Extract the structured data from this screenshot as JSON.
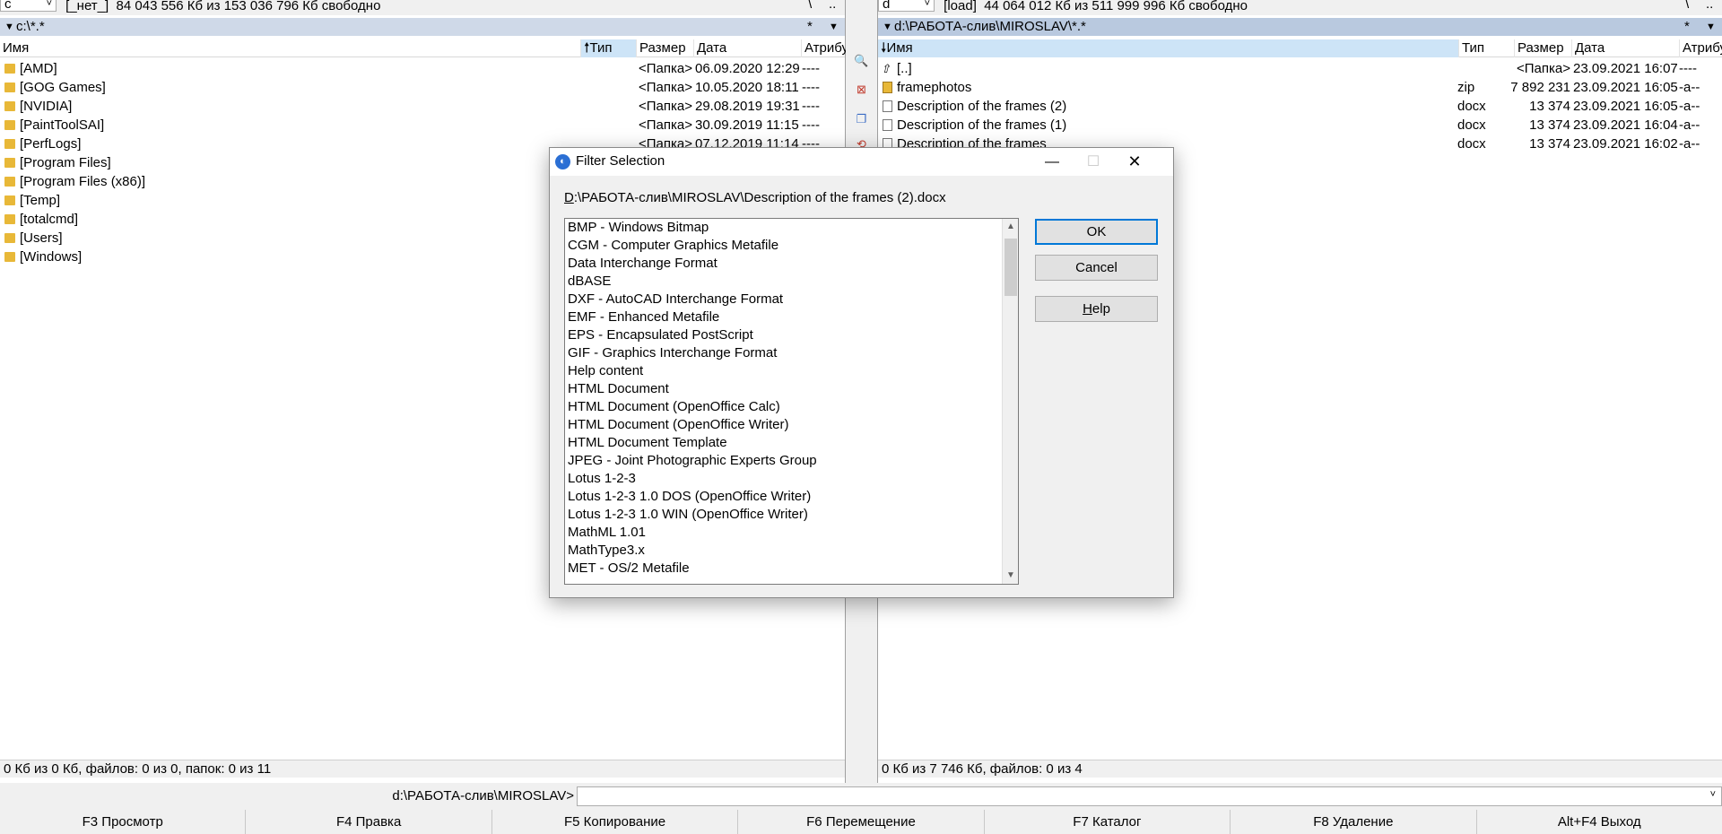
{
  "left_panel": {
    "drive": "c",
    "drive_label": "[_нет_]",
    "free_space": "84 043 556 Кб из 153 036 796 Кб свободно",
    "root_btn": "\\",
    "parent_btn": "..",
    "path": "c:\\*.*",
    "path_star": "*",
    "columns": {
      "name": "Имя",
      "type": "Тип",
      "size": "Размер",
      "date": "Дата",
      "attr": "Атрибу"
    },
    "rows": [
      {
        "name": "[AMD]",
        "size": "<Папка>",
        "date": "06.09.2020 12:29",
        "attr": "----"
      },
      {
        "name": "[GOG Games]",
        "size": "<Папка>",
        "date": "10.05.2020 18:11",
        "attr": "----"
      },
      {
        "name": "[NVIDIA]",
        "size": "<Папка>",
        "date": "29.08.2019 19:31",
        "attr": "----"
      },
      {
        "name": "[PaintToolSAI]",
        "size": "<Папка>",
        "date": "30.09.2019 11:15",
        "attr": "----"
      },
      {
        "name": "[PerfLogs]",
        "size": "<Папка>",
        "date": "07.12.2019 11:14",
        "attr": "----"
      },
      {
        "name": "[Program Files]",
        "size": "",
        "date": "",
        "attr": ""
      },
      {
        "name": "[Program Files (x86)]",
        "size": "",
        "date": "",
        "attr": ""
      },
      {
        "name": "[Temp]",
        "size": "",
        "date": "",
        "attr": ""
      },
      {
        "name": "[totalcmd]",
        "size": "",
        "date": "",
        "attr": ""
      },
      {
        "name": "[Users]",
        "size": "",
        "date": "",
        "attr": ""
      },
      {
        "name": "[Windows]",
        "size": "",
        "date": "",
        "attr": ""
      }
    ],
    "status": "0 Кб из 0 Кб, файлов: 0 из 0, папок: 0 из 11"
  },
  "right_panel": {
    "drive": "d",
    "drive_label": "[load]",
    "free_space": "44 064 012 Кб из 511 999 996 Кб свободно",
    "root_btn": "\\",
    "parent_btn": "..",
    "path": "d:\\РАБОТА-слив\\MIROSLAV\\*.*",
    "path_star": "*",
    "columns": {
      "name": "Имя",
      "type": "Тип",
      "size": "Размер",
      "date": "Дата",
      "attr": "Атрибу"
    },
    "rows": [
      {
        "name": "[..]",
        "type": "",
        "size": "<Папка>",
        "date": "23.09.2021 16:07",
        "attr": "----",
        "icon": "up-dir-icon"
      },
      {
        "name": "framephotos",
        "type": "zip",
        "size": "7 892 231",
        "date": "23.09.2021 16:05",
        "attr": "-a--",
        "icon": "zip-icon"
      },
      {
        "name": "Description of the frames (2)",
        "type": "docx",
        "size": "13 374",
        "date": "23.09.2021 16:05",
        "attr": "-a--",
        "icon": "file-icon"
      },
      {
        "name": "Description of the frames (1)",
        "type": "docx",
        "size": "13 374",
        "date": "23.09.2021 16:04",
        "attr": "-a--",
        "icon": "file-icon"
      },
      {
        "name": "Description of the frames",
        "type": "docx",
        "size": "13 374",
        "date": "23.09.2021 16:02",
        "attr": "-a--",
        "icon": "file-icon"
      }
    ],
    "status": "0 Кб из 7 746 Кб, файлов: 0 из 4"
  },
  "command_line": {
    "prompt": "d:\\РАБОТА-слив\\MIROSLAV>",
    "value": ""
  },
  "function_keys": [
    "F3 Просмотр",
    "F4 Правка",
    "F5 Копирование",
    "F6 Перемещение",
    "F7 Каталог",
    "F8 Удаление",
    "Alt+F4 Выход"
  ],
  "dialog": {
    "title": "Filter Selection",
    "path_first": "D",
    "path_rest": ":\\РАБОТА-слив\\MIROSLAV\\Description of the frames (2).docx",
    "filters": [
      "BMP - Windows Bitmap",
      "CGM - Computer Graphics Metafile",
      "Data Interchange Format",
      "dBASE",
      "DXF - AutoCAD Interchange Format",
      "EMF - Enhanced Metafile",
      "EPS - Encapsulated PostScript",
      "GIF - Graphics Interchange Format",
      "Help content",
      "HTML Document",
      "HTML Document (OpenOffice Calc)",
      "HTML Document (OpenOffice Writer)",
      "HTML Document Template",
      "JPEG - Joint Photographic Experts Group",
      "Lotus 1-2-3",
      "Lotus 1-2-3 1.0 DOS (OpenOffice Writer)",
      "Lotus 1-2-3 1.0 WIN (OpenOffice Writer)",
      "MathML 1.01",
      "MathType3.x",
      "MET - OS/2 Metafile"
    ],
    "buttons": {
      "ok": "OK",
      "cancel": "Cancel",
      "help_first": "H",
      "help_rest": "elp"
    }
  }
}
